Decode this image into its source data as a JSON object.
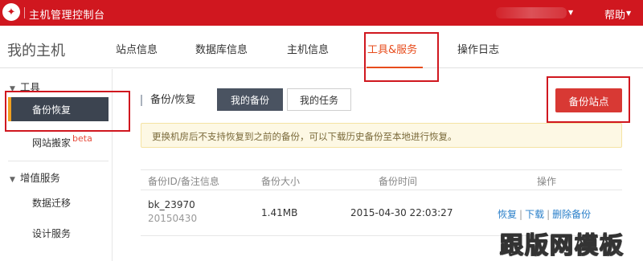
{
  "topbar": {
    "title": "主机管理控制台",
    "help": "帮助"
  },
  "header": {
    "page_title": "我的主机",
    "nav": [
      "站点信息",
      "数据库信息",
      "主机信息",
      "工具&服务",
      "操作日志"
    ],
    "active_nav": "工具&服务"
  },
  "sidebar": {
    "groups": [
      {
        "label": "工具",
        "items": [
          "备份恢复",
          "网站搬家"
        ]
      },
      {
        "label": "增值服务",
        "items": [
          "数据迁移",
          "设计服务"
        ]
      }
    ],
    "active_item": "备份恢复",
    "beta_badge": "beta"
  },
  "main": {
    "section_label": "备份/恢复",
    "tabs": [
      "我的备份",
      "我的任务"
    ],
    "active_tab": "我的备份",
    "primary_button": "备份站点",
    "notice": "更换机房后不支持恢复到之前的备份，可以下载历史备份至本地进行恢复。",
    "table": {
      "headers": [
        "备份ID/备注信息",
        "备份大小",
        "备份时间",
        "操作"
      ],
      "rows": [
        {
          "id": "bk_23970",
          "note": "20150430",
          "size": "1.41MB",
          "time": "2015-04-30 22:03:27",
          "actions": [
            "恢复",
            "下载",
            "删除备份"
          ]
        }
      ]
    }
  },
  "watermark": "跟版网模板",
  "colors": {
    "topbar": "#d0171f",
    "accent": "#e74c1c",
    "primary_button": "#d83934",
    "sidebar_active": "#3c4450",
    "link": "#2a7fc9"
  }
}
